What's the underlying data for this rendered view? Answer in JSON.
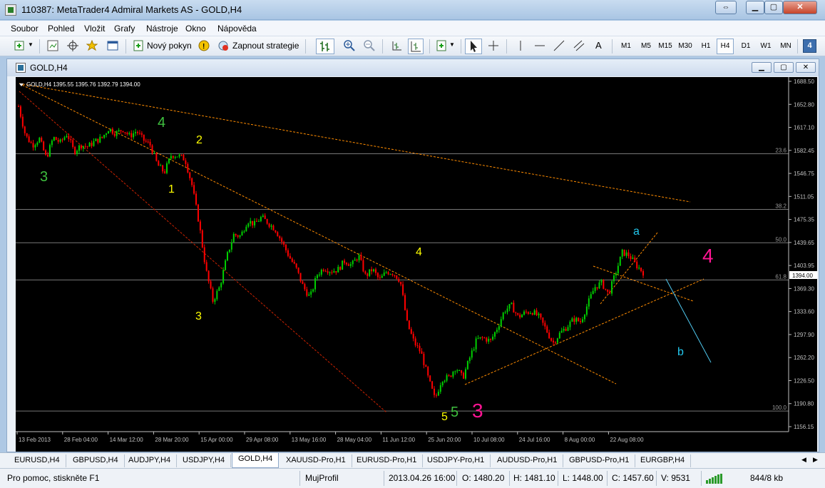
{
  "window": {
    "title": "110387: MetaTrader4 Admiral Markets AS - GOLD,H4"
  },
  "menu": [
    "Soubor",
    "Pohled",
    "Vložit",
    "Grafy",
    "Nástroje",
    "Okno",
    "Nápověda"
  ],
  "toolbar": {
    "new_order": "Nový pokyn",
    "auto_trading": "Zapnout strategie",
    "text_tool": "A",
    "timeframes": [
      "M1",
      "M5",
      "M15",
      "M30",
      "H1",
      "H4",
      "D1",
      "W1",
      "MN"
    ],
    "active_timeframe": "H4",
    "badge": "4"
  },
  "chart_window": {
    "title": "GOLD,H4"
  },
  "chart_data": {
    "type": "candlestick",
    "header": "GOLD,H4  1395.55 1395.76 1392.79 1394.00",
    "y_ticks": [
      "1688.50",
      "1652.80",
      "1617.10",
      "1582.45",
      "1546.75",
      "1511.05",
      "1475.35",
      "1439.65",
      "1403.95",
      "1369.30",
      "1333.60",
      "1297.90",
      "1262.20",
      "1226.50",
      "1190.80",
      "1156.15"
    ],
    "current_price": "1394.00",
    "x_ticks": [
      "13 Feb 2013",
      "28 Feb 04:00",
      "14 Mar 12:00",
      "28 Mar 20:00",
      "15 Apr 00:00",
      "29 Apr 08:00",
      "13 May 16:00",
      "28 May 04:00",
      "11 Jun 12:00",
      "25 Jun 20:00",
      "10 Jul 08:00",
      "24 Jul 16:00",
      "8 Aug 00:00",
      "22 Aug 08:00"
    ],
    "fibo_levels": [
      {
        "label": "23.6",
        "price": 1576.9
      },
      {
        "label": "38.2",
        "price": 1491.0
      },
      {
        "label": "50.0",
        "price": 1439.6
      },
      {
        "label": "61.8",
        "price": 1382.3
      },
      {
        "label": "100.0",
        "price": 1180.2
      }
    ],
    "price_path": [
      1650,
      1605,
      1590,
      1600,
      1570,
      1602,
      1594,
      1608,
      1580,
      1590,
      1588,
      1596,
      1601,
      1616,
      1608,
      1615,
      1604,
      1612,
      1598,
      1590,
      1560,
      1548,
      1575,
      1574,
      1568,
      1528,
      1470,
      1398,
      1350,
      1372,
      1418,
      1452,
      1450,
      1474,
      1468,
      1479,
      1470,
      1460,
      1440,
      1418,
      1400,
      1372,
      1355,
      1390,
      1401,
      1396,
      1398,
      1412,
      1405,
      1420,
      1388,
      1399,
      1382,
      1395,
      1393,
      1381,
      1315,
      1286,
      1270,
      1232,
      1198,
      1230,
      1232,
      1248,
      1231,
      1262,
      1290,
      1293,
      1288,
      1309,
      1335,
      1343,
      1325,
      1332,
      1334,
      1325,
      1306,
      1285,
      1300,
      1310,
      1322,
      1318,
      1345,
      1371,
      1378,
      1360,
      1392,
      1425,
      1420,
      1405,
      1394
    ],
    "wave_labels": [
      {
        "text": "3",
        "color": "#3fbf3f",
        "size": 20
      },
      {
        "text": "4",
        "color": "#3fbf3f",
        "size": 20
      },
      {
        "text": "2",
        "color": "#ffff00",
        "size": 16
      },
      {
        "text": "1",
        "color": "#ffff00",
        "size": 16
      },
      {
        "text": "3",
        "color": "#ffff00",
        "size": 16
      },
      {
        "text": "4",
        "color": "#ffff00",
        "size": 16
      },
      {
        "text": "5",
        "color": "#ffff00",
        "size": 16
      },
      {
        "text": "5",
        "color": "#3fbf3f",
        "size": 20
      },
      {
        "text": "3",
        "color": "#ff1493",
        "size": 28
      },
      {
        "text": "a",
        "color": "#22c8ee",
        "size": 16
      },
      {
        "text": "4",
        "color": "#ff1493",
        "size": 28
      },
      {
        "text": "b",
        "color": "#22c8ee",
        "size": 16
      }
    ],
    "colors": {
      "bull": "#00d000",
      "bear": "#ff0000",
      "trendline": "#ff8c00",
      "red_line": "#cc2200",
      "fibo": "#777777",
      "wave_b_line": "#4fc8ee"
    }
  },
  "tabs": [
    "EURUSD,H4",
    "GBPUSD,H4",
    "AUDJPY,H4",
    "USDJPY,H4",
    "GOLD,H4",
    "XAUUSD-Pro,H1",
    "EURUSD-Pro,H1",
    "USDJPY-Pro,H1",
    "AUDUSD-Pro,H1",
    "GBPUSD-Pro,H1",
    "EURGBP,H4"
  ],
  "active_tab": "GOLD,H4",
  "status": {
    "help": "Pro pomoc, stiskněte F1",
    "profile": "MujProfil",
    "datetime": "2013.04.26 16:00",
    "open": "O: 1480.20",
    "high": "H: 1481.10",
    "low": "L: 1448.00",
    "close": "C: 1457.60",
    "volume": "V: 9531",
    "traffic": "844/8 kb"
  }
}
